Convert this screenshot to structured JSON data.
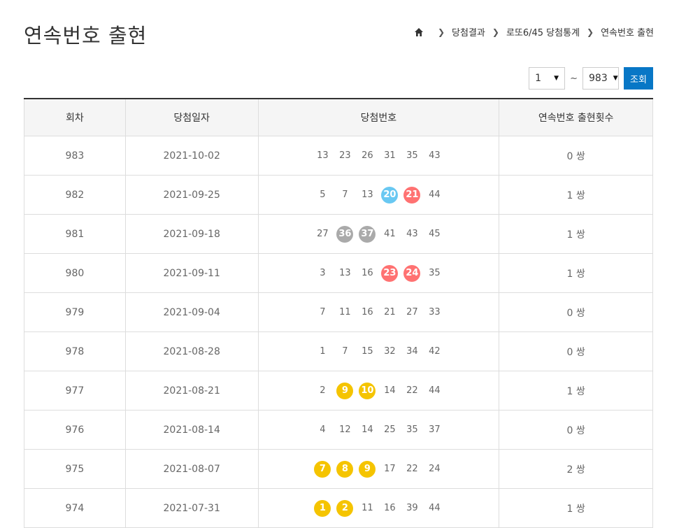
{
  "page": {
    "title": "연속번호 출현"
  },
  "breadcrumb": {
    "items": [
      "당첨결과",
      "로또6/45 당첨통계",
      "연속번호 출현"
    ]
  },
  "controls": {
    "from_value": "1",
    "tilde": "~",
    "to_value": "983",
    "search_label": "조회"
  },
  "colors": {
    "yellow": "#f5c400",
    "blue": "#69c8f2",
    "red": "#ff7272",
    "gray": "#aaaaaa",
    "green": "#b0d840",
    "button": "#0877c6"
  },
  "table": {
    "headers": [
      "회차",
      "당첨일자",
      "당첨번호",
      "연속번호 출현횟수"
    ],
    "rows": [
      {
        "round": "983",
        "date": "2021-10-02",
        "numbers": [
          13,
          23,
          26,
          31,
          35,
          43
        ],
        "highlight": [],
        "count": "0 쌍"
      },
      {
        "round": "982",
        "date": "2021-09-25",
        "numbers": [
          5,
          7,
          13,
          20,
          21,
          44
        ],
        "highlight": [
          20,
          21
        ],
        "count": "1 쌍"
      },
      {
        "round": "981",
        "date": "2021-09-18",
        "numbers": [
          27,
          36,
          37,
          41,
          43,
          45
        ],
        "highlight": [
          36,
          37
        ],
        "count": "1 쌍"
      },
      {
        "round": "980",
        "date": "2021-09-11",
        "numbers": [
          3,
          13,
          16,
          23,
          24,
          35
        ],
        "highlight": [
          23,
          24
        ],
        "count": "1 쌍"
      },
      {
        "round": "979",
        "date": "2021-09-04",
        "numbers": [
          7,
          11,
          16,
          21,
          27,
          33
        ],
        "highlight": [],
        "count": "0 쌍"
      },
      {
        "round": "978",
        "date": "2021-08-28",
        "numbers": [
          1,
          7,
          15,
          32,
          34,
          42
        ],
        "highlight": [],
        "count": "0 쌍"
      },
      {
        "round": "977",
        "date": "2021-08-21",
        "numbers": [
          2,
          9,
          10,
          14,
          22,
          44
        ],
        "highlight": [
          9,
          10
        ],
        "count": "1 쌍"
      },
      {
        "round": "976",
        "date": "2021-08-14",
        "numbers": [
          4,
          12,
          14,
          25,
          35,
          37
        ],
        "highlight": [],
        "count": "0 쌍"
      },
      {
        "round": "975",
        "date": "2021-08-07",
        "numbers": [
          7,
          8,
          9,
          17,
          22,
          24
        ],
        "highlight": [
          7,
          8,
          9
        ],
        "count": "2 쌍"
      },
      {
        "round": "974",
        "date": "2021-07-31",
        "numbers": [
          1,
          2,
          11,
          16,
          39,
          44
        ],
        "highlight": [
          1,
          2
        ],
        "count": "1 쌍"
      }
    ]
  }
}
